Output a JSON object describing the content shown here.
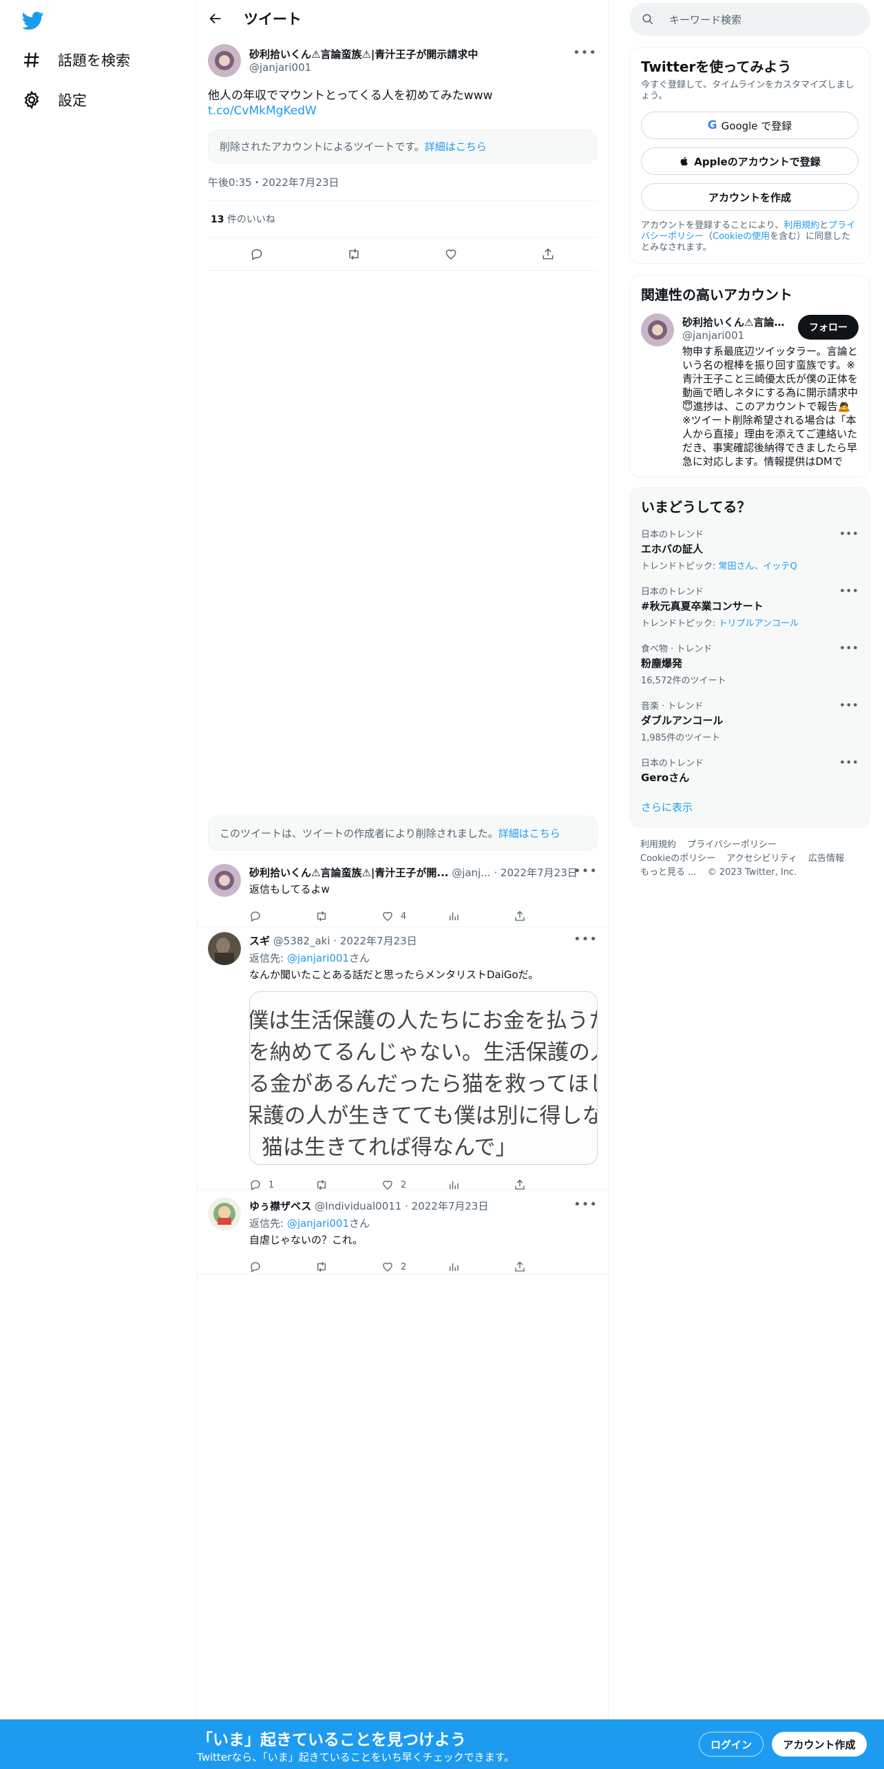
{
  "nav": {
    "explore_label": "話題を検索",
    "settings_label": "設定"
  },
  "header": {
    "title": "ツイート"
  },
  "tweet": {
    "author_name": "砂利拾いくん⚠言論蛮族⚠|青汁王子が開示請求中",
    "author_handle": "@janjari001",
    "text": "他人の年収でマウントとってくる人を初めてみたwww",
    "link": "t.co/CvMkMgKedW",
    "quoted_deleted_text": "削除されたアカウントによるツイートです。",
    "learn_more": "詳細はこちら",
    "timestamp": "午後0:35・2022年7月23日",
    "likes_count": "13",
    "likes_label": "件のいいね"
  },
  "deleted_notice": {
    "text": "このツイートは、ツイートの作成者により削除されました。",
    "link": "詳細はこちら"
  },
  "replies": [
    {
      "name": "砂利拾いくん⚠言論蛮族⚠|青汁王子が開...",
      "handle": "@janj...",
      "date": "· 2022年7月23日",
      "text": "返信もしてるよw",
      "replies": "",
      "likes": "4"
    },
    {
      "name": "スギ",
      "handle": "@5382_aki",
      "date": "· 2022年7月23日",
      "reply_to_label": "返信先: ",
      "reply_to_handle": "@janjari001",
      "reply_to_suffix": "さん",
      "text": "なんか聞いたことある話だと思ったらメンタリストDaiGoだ。",
      "media_lines": [
        "僕は生活保護の人たちにお金を払うために税",
        "を納めてるんじゃない。生活保護の人に食わ",
        "る金があるんだったら猫を救ってほしい。生",
        "保護の人が生きてても僕は別に得しないけど",
        "、猫は生きてれば得なんで」"
      ],
      "replies": "1",
      "likes": "2"
    },
    {
      "name": "ゆぅ襟ザベス",
      "handle": "@Individual0011",
      "date": "· 2022年7月23日",
      "reply_to_label": "返信先: ",
      "reply_to_handle": "@janjari001",
      "reply_to_suffix": "さん",
      "text": "自虐じゃないの？これ。",
      "replies": "",
      "likes": "2"
    }
  ],
  "sidebar": {
    "search_placeholder": "キーワード検索",
    "join": {
      "title": "Twitterを使ってみよう",
      "desc": "今すぐ登録して、タイムラインをカスタマイズしましょう。",
      "google": "Google で登録",
      "apple": "Appleのアカウントで登録",
      "create": "アカウントを作成",
      "legal_pre": "アカウントを登録することにより、",
      "legal_terms": "利用規約",
      "legal_and": "と",
      "legal_privacy": "プライバシーポリシー",
      "legal_mid": "（",
      "legal_cookie": "Cookieの使用",
      "legal_post": "を含む）に同意したとみなされます。"
    },
    "relevant": {
      "title": "関連性の高いアカウント",
      "name": "砂利拾いくん⚠言論蛮族⚠|青汁王子が開示請求中",
      "handle": "@janjari001",
      "follow": "フォロー",
      "bio": "物申す系最底辺ツイッタラー。言論という名の棍棒を振り回す蛮族です。※青汁王子こと三崎優太氏が僕の正体を動画で晒しネタにする為に開示請求中😇進捗は、このアカウントで報告🙇※ツイート削除希望される場合は「本人から直接」理由を添えてご連絡いただき、事実確認後納得できましたら早急に対応します。情報提供はDMで"
    },
    "trends": {
      "title": "いまどうしてる？",
      "items": [
        {
          "context": "日本のトレンド",
          "title": "エホバの証人",
          "sub_label": "トレンドトピック: ",
          "sub_link": "常田さん、イッテQ"
        },
        {
          "context": "日本のトレンド",
          "title": "#秋元真夏卒業コンサート",
          "sub_label": "トレンドトピック: ",
          "sub_link": "トリプルアンコール"
        },
        {
          "context": "食べ物 · トレンド",
          "title": "粉塵爆発",
          "sub_label": "16,572件のツイート",
          "sub_link": ""
        },
        {
          "context": "音楽 · トレンド",
          "title": "ダブルアンコール",
          "sub_label": "1,985件のツイート",
          "sub_link": ""
        },
        {
          "context": "日本のトレンド",
          "title": "Geroさん",
          "sub_label": "",
          "sub_link": ""
        }
      ],
      "show_more": "さらに表示"
    },
    "footer": {
      "terms": "利用規約",
      "privacy": "プライバシーポリシー",
      "cookie": "Cookieのポリシー",
      "accessibility": "アクセシビリティ",
      "ads": "広告情報",
      "more": "もっと見る ...",
      "copyright": "© 2023 Twitter, Inc."
    }
  },
  "bottom_bar": {
    "title": "「いま」起きていることを見つけよう",
    "subtitle": "Twitterなら、「いま」起きていることをいち早くチェックできます。",
    "login": "ログイン",
    "signup": "アカウント作成"
  },
  "colors": {
    "accent": "#1d9bf0",
    "text": "#0f1419",
    "secondary": "#536471",
    "border": "#eff3f4"
  },
  "icons": {
    "logo": "twitter-bird-icon",
    "explore": "hashtag-icon",
    "settings": "gear-icon",
    "back": "arrow-left-icon",
    "reply": "reply-icon",
    "retweet": "retweet-icon",
    "like": "heart-icon",
    "views": "analytics-icon",
    "share": "share-icon"
  }
}
